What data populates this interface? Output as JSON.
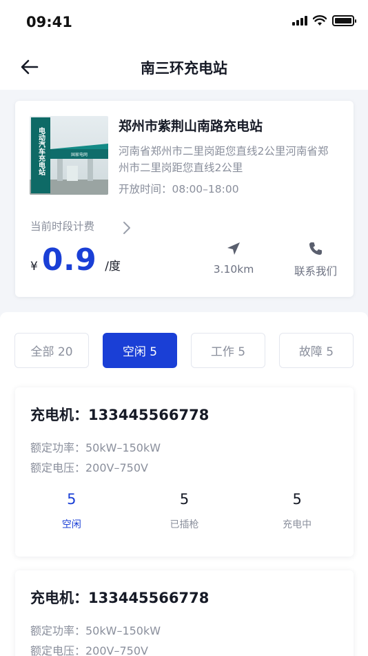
{
  "status_bar": {
    "time": "09:41"
  },
  "nav": {
    "title": "南三环充电站"
  },
  "station": {
    "name": "郑州市紫荆山南路充电站",
    "address": "河南省郑州市二里岗距您直线2公里河南省郑州市二里岗距您直线2公里",
    "hours": "开放时间：08:00–18:00",
    "fee_label": "当前时段计费",
    "currency": "¥",
    "price": "0.9",
    "unit": "/度",
    "distance": "3.10km",
    "contact": "联系我们",
    "photo_sign_text": "电动汽车充电站",
    "photo_canopy_text": "国家电网"
  },
  "tabs": [
    {
      "label": "全部 20",
      "active": false
    },
    {
      "label": "空闲 5",
      "active": true
    },
    {
      "label": "工作 5",
      "active": false
    },
    {
      "label": "故障 5",
      "active": false
    }
  ],
  "chargers": [
    {
      "title": "充电机：133445566778",
      "power": "额定功率：50kW–150kW",
      "voltage": "额定电压：200V–750V",
      "stats": [
        {
          "value": "5",
          "label": "空闲"
        },
        {
          "value": "5",
          "label": "已插枪"
        },
        {
          "value": "5",
          "label": "充电中"
        }
      ]
    },
    {
      "title": "充电机：133445566778",
      "power": "额定功率：50kW–150kW",
      "voltage": "额定电压：200V–750V"
    }
  ],
  "colors": {
    "accent": "#1a3fd6",
    "muted": "#8a8f9c",
    "background": "#f3f5f9"
  },
  "icons": [
    "back-arrow-icon",
    "chevron-right-icon",
    "navigation-arrow-icon",
    "phone-icon",
    "signal-icon",
    "wifi-icon",
    "battery-icon"
  ]
}
